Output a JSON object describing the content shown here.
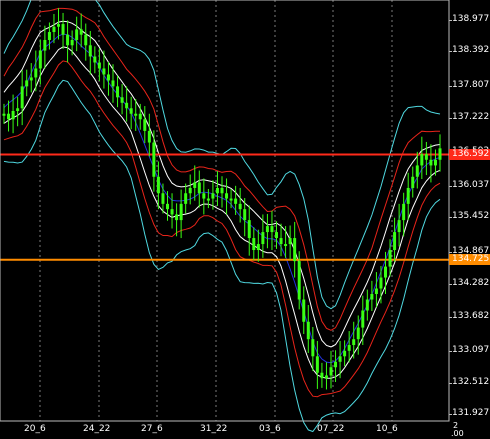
{
  "chart_data": {
    "type": "candlestick",
    "y_tick_labels": [
      "138.977",
      "138.392",
      "137.807",
      "137.222",
      "136.592",
      "136.037",
      "135.452",
      "134.867",
      "134.282",
      "133.682",
      "133.097",
      "132.512",
      "131.927"
    ],
    "y_ticks": [
      138.977,
      138.392,
      137.807,
      137.222,
      136.637,
      136.037,
      135.452,
      134.867,
      134.282,
      133.682,
      133.097,
      132.512,
      131.927
    ],
    "ylim": [
      131.9,
      139.35
    ],
    "x_tick_labels": [
      "20_6",
      "24_22",
      "27_6",
      "31_22",
      "03_6",
      "07_22",
      "10_6"
    ],
    "grid": true,
    "horizontal_levels": [
      {
        "label": "136.592",
        "value": 136.592,
        "color": "#ff2a1a"
      },
      {
        "label": "134.725",
        "value": 134.725,
        "color": "#ff8c00"
      }
    ],
    "colors": {
      "candle": "#39ff14",
      "band_cyan": "#4fd8e0",
      "band_red": "#e8241a",
      "band_white": "#ffffff",
      "band_blue": "#2233dd",
      "grid": "#7a7a7a",
      "background": "#000000"
    },
    "close_path": [
      137.3,
      137.2,
      137.35,
      137.4,
      137.8,
      137.9,
      137.95,
      138.1,
      138.4,
      138.6,
      138.75,
      138.85,
      138.9,
      138.7,
      138.5,
      138.6,
      138.8,
      138.7,
      138.5,
      138.3,
      138.2,
      138.1,
      138.0,
      137.9,
      137.8,
      137.6,
      137.5,
      137.4,
      137.3,
      137.3,
      137.2,
      137.0,
      136.8,
      136.2,
      135.9,
      135.7,
      135.6,
      135.5,
      135.4,
      135.7,
      135.9,
      136.0,
      136.1,
      135.9,
      135.8,
      135.8,
      135.9,
      136.0,
      135.9,
      135.8,
      135.8,
      135.7,
      135.6,
      135.4,
      135.1,
      134.9,
      135.0,
      135.2,
      135.3,
      135.2,
      135.1,
      135.0,
      135.0,
      135.1,
      134.7,
      134.0,
      133.6,
      133.3,
      133.0,
      132.7,
      132.6,
      132.65,
      132.8,
      132.9,
      133.0,
      133.1,
      133.2,
      133.3,
      133.5,
      133.8,
      134.0,
      134.1,
      134.2,
      134.4,
      134.6,
      134.9,
      135.2,
      135.4,
      135.7,
      136.0,
      136.2,
      136.4,
      136.6,
      136.5,
      136.4,
      136.5,
      136.7
    ]
  },
  "time_row": {
    "bottom_right": "2",
    "bottom_right_2": ".00"
  }
}
